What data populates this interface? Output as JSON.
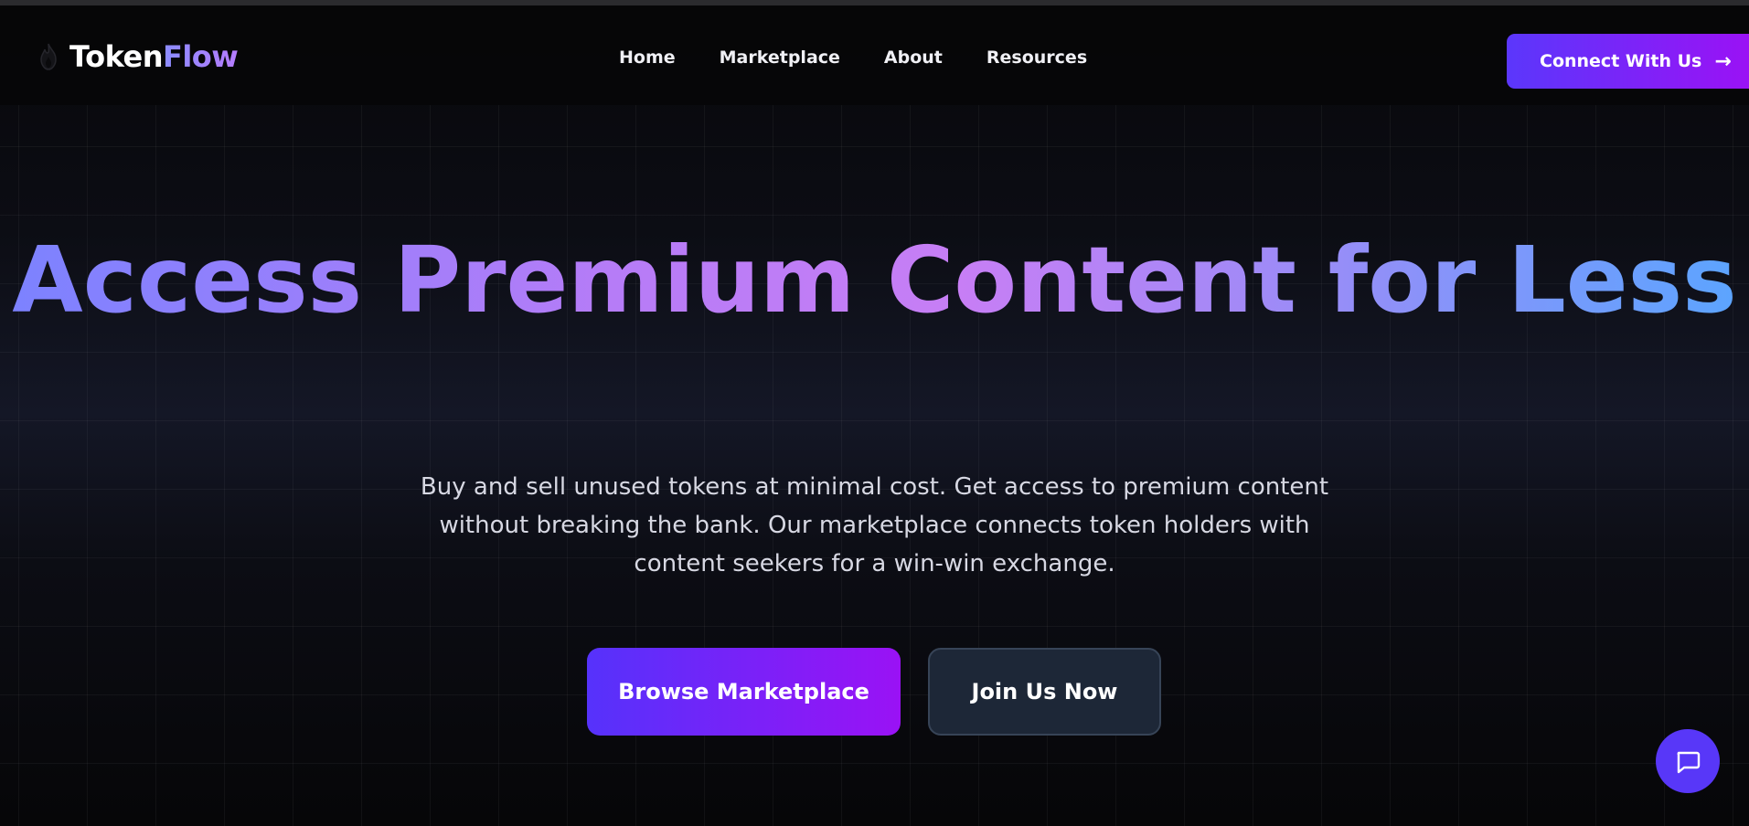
{
  "brand": {
    "name_part1": "Token",
    "name_part2": "Flow",
    "logo_icon": "flame-icon"
  },
  "nav": {
    "links": [
      {
        "label": "Home"
      },
      {
        "label": "Marketplace"
      },
      {
        "label": "About"
      },
      {
        "label": "Resources"
      }
    ],
    "cta_label": "Connect With Us",
    "cta_icon": "arrow-right-icon"
  },
  "hero": {
    "title": "Access Premium Content for Less",
    "subtitle": "Buy and sell unused tokens at minimal cost. Get access to premium content without breaking the bank. Our marketplace connects token holders with content seekers for a win-win exchange.",
    "primary_button": "Browse Marketplace",
    "secondary_button": "Join Us Now"
  },
  "chat": {
    "icon": "chat-bubble-icon"
  },
  "colors": {
    "background": "#060608",
    "accent_start": "#5b37fb",
    "accent_end": "#9a12f5",
    "secondary_button": "#1d2737",
    "text": "#ffffff"
  }
}
